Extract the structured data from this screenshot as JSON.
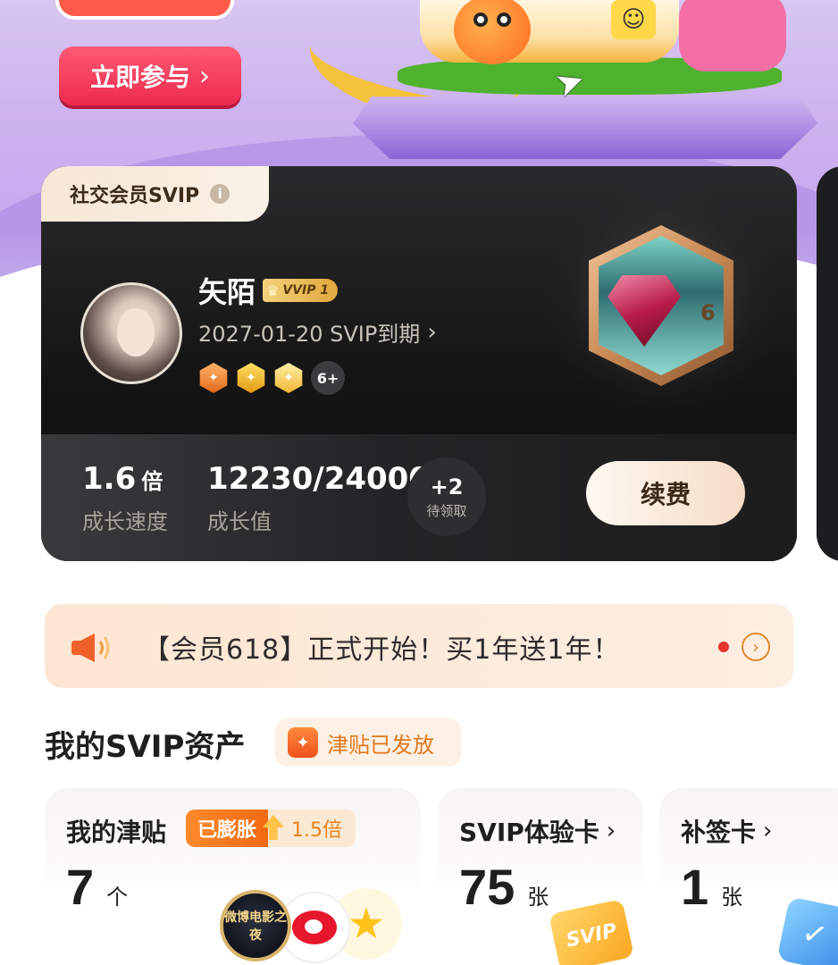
{
  "banner": {
    "join_label": "立即参与",
    "join_chevron": "›"
  },
  "member_card": {
    "tab_label": "社交会员SVIP",
    "info_icon": "i",
    "username": "矢陌",
    "vip_level_label": "VVIP 1",
    "expire_text": "2027-01-20 SVIP到期",
    "expire_chevron": "›",
    "medals": [
      "medal-1",
      "medal-2",
      "medal-3"
    ],
    "more_medals": "6+",
    "gem_level": "6",
    "speed_value": "1.6",
    "speed_unit": "倍",
    "speed_label": "成长速度",
    "growth_value": "12230/24000",
    "growth_label": "成长值",
    "pending_value": "+2",
    "pending_label": "待领取",
    "renew_label": "续费"
  },
  "notice": {
    "text": "【会员618】正式开始！买1年送1年！",
    "arrow": "›"
  },
  "assets": {
    "title": "我的SVIP资产",
    "subsidy_tag": "津贴已发放",
    "cards": [
      {
        "title": "我的津贴",
        "expanded_label": "已膨胀",
        "multiplier": "1.5倍",
        "count": "7",
        "unit": "个",
        "token_label": "微博电影之夜"
      },
      {
        "title": "SVIP体验卡",
        "chevron": "›",
        "count": "75",
        "unit": "张",
        "icon_label": "SVIP"
      },
      {
        "title": "补签卡",
        "chevron": "›",
        "count": "1",
        "unit": "张"
      }
    ]
  },
  "colors": {
    "join_button": "#ec2a4e",
    "card_background": "#141414",
    "accent_orange": "#f26a12",
    "notice_background": "#fde6d3"
  }
}
